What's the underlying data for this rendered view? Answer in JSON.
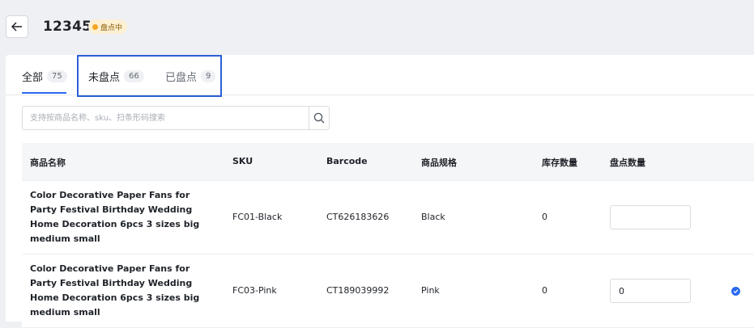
{
  "header": {
    "title": "12345",
    "status": "盘点中",
    "colors": {
      "status_bg": "#fdf0d3",
      "status_dot": "#f5a623"
    }
  },
  "tabs": [
    {
      "label": "全部",
      "count": "75"
    },
    {
      "label": "未盘点",
      "count": "66"
    },
    {
      "label": "已盘点",
      "count": "9"
    }
  ],
  "search": {
    "placeholder": "支持按商品名称、sku、扫条形码搜索"
  },
  "table": {
    "columns": [
      "商品名称",
      "SKU",
      "Barcode",
      "商品规格",
      "库存数量",
      "盘点数量"
    ],
    "rows": [
      {
        "name": "Color Decorative Paper Fans for Party Festival Birthday Wedding Home Decoration 6pcs 3 sizes big medium small",
        "sku": "FC01-Black",
        "barcode": "CT626183626",
        "spec": "Black",
        "stock": "0",
        "count": ""
      },
      {
        "name": "Color Decorative Paper Fans for Party Festival Birthday Wedding Home Decoration 6pcs 3 sizes big medium small",
        "sku": "FC03-Pink",
        "barcode": "CT189039992",
        "spec": "Pink",
        "stock": "0",
        "count": "0"
      }
    ]
  },
  "accent_color": "#2a6af0"
}
